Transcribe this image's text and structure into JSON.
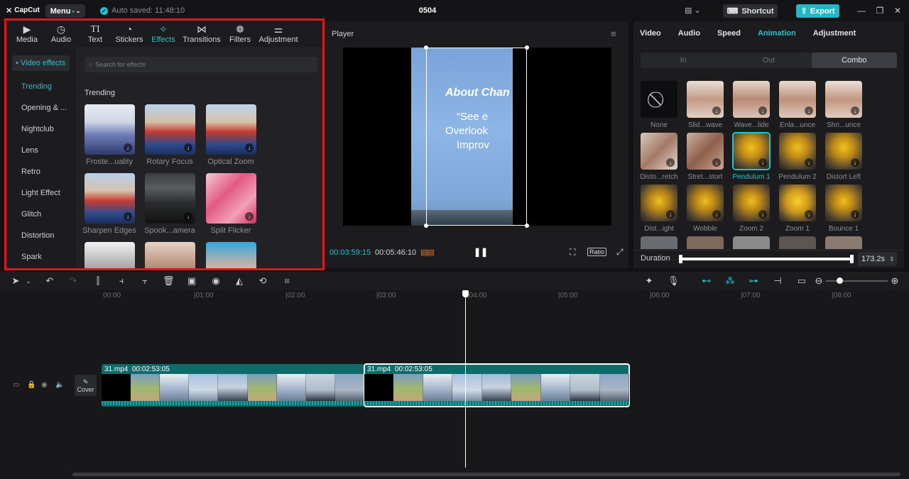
{
  "app": {
    "logo": "CapCut",
    "menu_label": "Menu",
    "autosave": "Auto saved: 11:48:10",
    "project": "0504",
    "shortcut_label": "Shortcut",
    "export_label": "Export"
  },
  "left_panel": {
    "tabs": [
      {
        "label": "Media",
        "icon": "▶"
      },
      {
        "label": "Audio",
        "icon": "◷"
      },
      {
        "label": "Text",
        "icon": "TI"
      },
      {
        "label": "Stickers",
        "icon": "◔"
      },
      {
        "label": "Effects",
        "icon": "✧"
      },
      {
        "label": "Transitions",
        "icon": "⋈"
      },
      {
        "label": "Filters",
        "icon": "❁"
      },
      {
        "label": "Adjustment",
        "icon": "⚌"
      }
    ],
    "category_header": "• Video effects",
    "categories": [
      "Trending",
      "Opening & ...",
      "Nightclub",
      "Lens",
      "Retro",
      "Light Effect",
      "Glitch",
      "Distortion",
      "Spark"
    ],
    "search_placeholder": "Search for effects",
    "section_title": "Trending",
    "effects": [
      {
        "label": "Froste...uality"
      },
      {
        "label": "Rotary Focus"
      },
      {
        "label": "Optical Zoom"
      },
      {
        "label": "Sharpen Edges"
      },
      {
        "label": "Spook...amera"
      },
      {
        "label": "Split Flicker"
      },
      {
        "label": ""
      },
      {
        "label": ""
      },
      {
        "label": ""
      }
    ]
  },
  "player": {
    "title": "Player",
    "overlay_title": "About Chan",
    "overlay_line1": "“See e",
    "overlay_line2": "Overlook",
    "overlay_line3": "Improv",
    "current_time": "00:03:59:15",
    "total_time": "00:05:46:10",
    "ratio_label": "Ratio"
  },
  "right_panel": {
    "tabs": [
      "Video",
      "Audio",
      "Speed",
      "Animation",
      "Adjustment"
    ],
    "active_tab": "Animation",
    "segments": [
      "In",
      "Out",
      "Combo"
    ],
    "active_segment": "Combo",
    "animations": [
      {
        "label": "None"
      },
      {
        "label": "Slid...wave"
      },
      {
        "label": "Wave...lide"
      },
      {
        "label": "Enla...unce"
      },
      {
        "label": "Shri...unce"
      },
      {
        "label": "Disto...retch"
      },
      {
        "label": "Stret...stort"
      },
      {
        "label": "Pendulum 1"
      },
      {
        "label": "Pendulum 2"
      },
      {
        "label": "Distort Left"
      },
      {
        "label": "Dist...ight"
      },
      {
        "label": "Wobble"
      },
      {
        "label": "Zoom 2"
      },
      {
        "label": "Zoom 1"
      },
      {
        "label": "Bounce 1"
      }
    ],
    "selected_animation": "Pendulum 1",
    "duration_label": "Duration",
    "duration_value": "173.2s",
    "duration_fill": 1.0
  },
  "timeline": {
    "ticks": [
      "00:00",
      "|01:00",
      "|02:00",
      "|03:00",
      "|04:00",
      "|05:00",
      "|06:00",
      "|07:00",
      "|08:00"
    ],
    "cover_label": "Cover",
    "clips": [
      {
        "name": "31.mp4",
        "duration": "00:02:53:05"
      },
      {
        "name": "31.mp4",
        "duration": "00:02:53:05"
      }
    ]
  },
  "colors": {
    "accent": "#22c3d0",
    "highlight": "#d71920",
    "clip": "#0f6b69"
  }
}
